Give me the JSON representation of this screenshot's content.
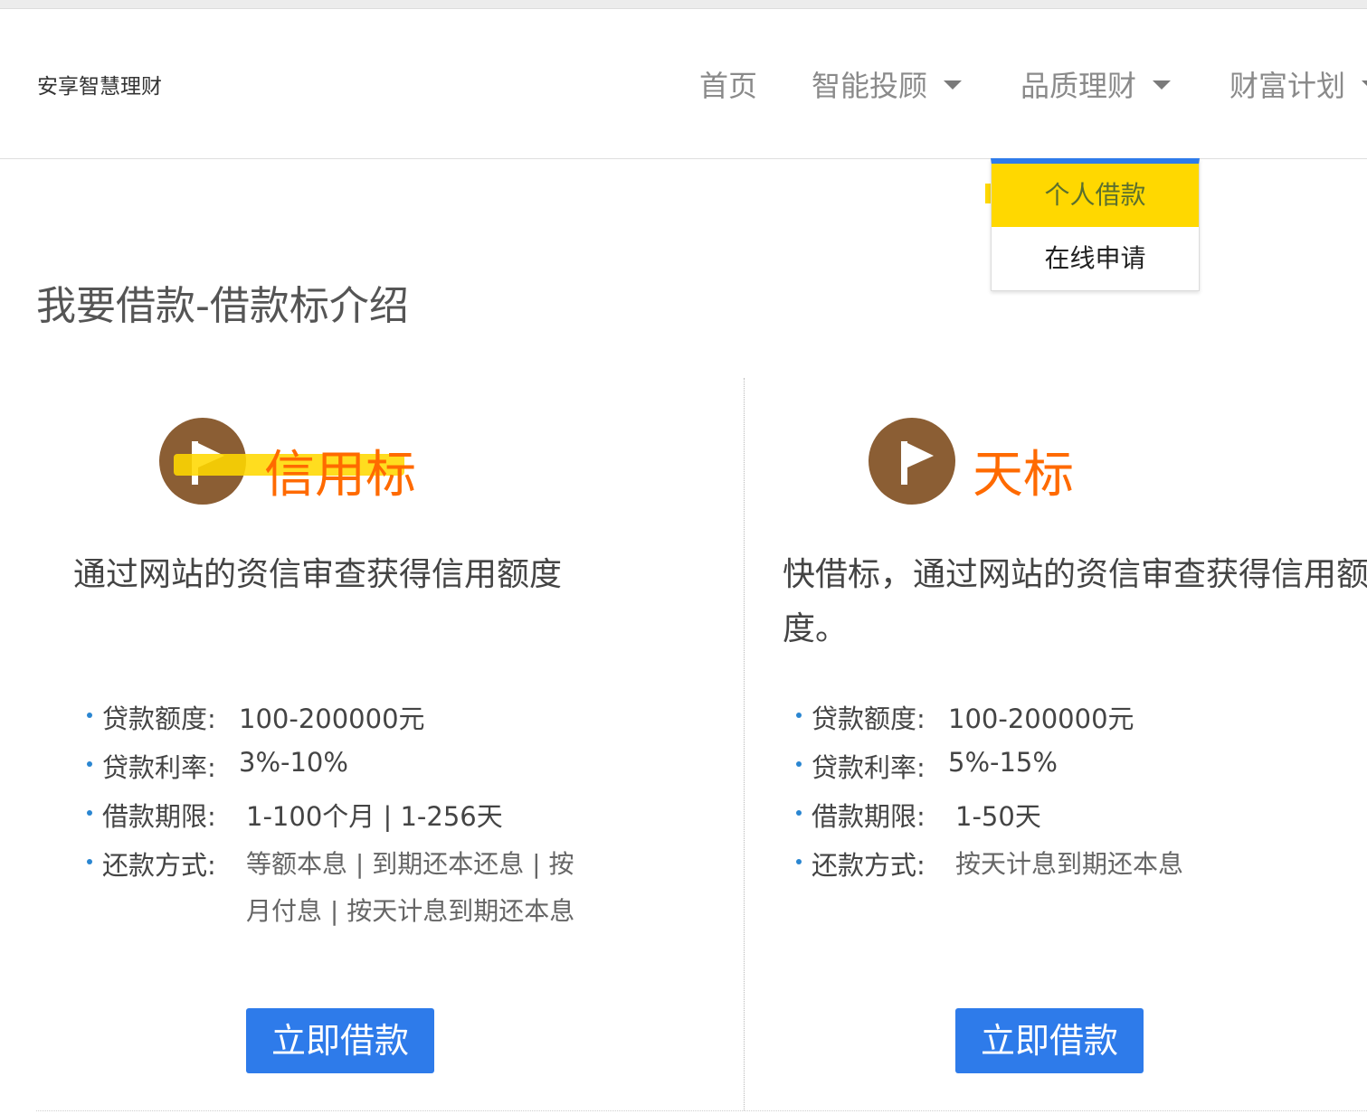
{
  "header": {
    "logo": "安享智慧理财",
    "nav": [
      {
        "label": "首页"
      },
      {
        "label": "智能投顾"
      },
      {
        "label": "品质理财"
      },
      {
        "label": "财富计划"
      }
    ]
  },
  "dropdown": {
    "items": [
      {
        "label": "个人借款"
      },
      {
        "label": "在线申请"
      }
    ]
  },
  "page_title": "我要借款-借款标介绍",
  "cards": [
    {
      "title": "信用标",
      "desc_lines": [
        "通过网站的资信审查获得信用额度"
      ],
      "specs": [
        {
          "label": "贷款额度:",
          "value": "100-200000元"
        },
        {
          "label": "贷款利率:",
          "value": "3%-10%"
        },
        {
          "label": "借款期限:",
          "value": "1-100个月 | 1-256天"
        },
        {
          "label": "还款方式:",
          "value_lines": [
            "等额本息 | 到期还本还息 | 按",
            "月付息 | 按天计息到期还本息"
          ]
        }
      ],
      "button": "立即借款"
    },
    {
      "title": "天标",
      "desc_lines": [
        "快借标，通过网站的资信审查获得信用额",
        "度。"
      ],
      "specs": [
        {
          "label": "贷款额度:",
          "value": "100-200000元"
        },
        {
          "label": "贷款利率:",
          "value": "5%-15%"
        },
        {
          "label": "借款期限:",
          "value": "1-50天"
        },
        {
          "label": "还款方式:",
          "value_lines": [
            "按天计息到期还本息"
          ]
        }
      ],
      "button": "立即借款"
    }
  ],
  "colors": {
    "accent": "#2e7bea",
    "title_orange": "#ff6a00",
    "highlight_yellow": "#ffd800",
    "icon_brown": "#8b5e34"
  }
}
